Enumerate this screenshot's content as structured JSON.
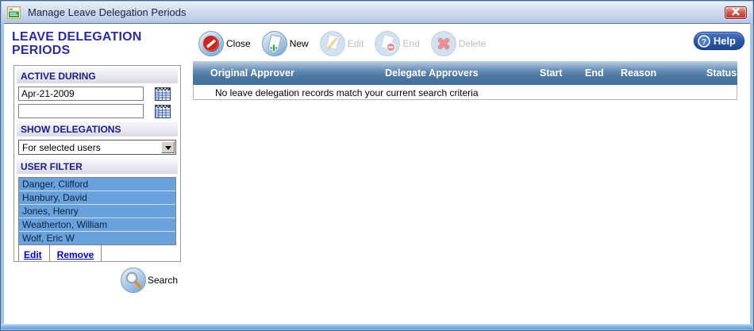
{
  "window": {
    "title": "Manage Leave Delegation Periods",
    "close_glyph": "x",
    "app_icon": "form-window-icon"
  },
  "page": {
    "heading": "LEAVE DELEGATION PERIODS"
  },
  "toolbar": {
    "buttons": [
      {
        "label": "Close",
        "icon": "close-icon",
        "enabled": true
      },
      {
        "label": "New",
        "icon": "new-icon",
        "enabled": true
      },
      {
        "label": "Edit",
        "icon": "edit-icon",
        "enabled": false
      },
      {
        "label": "End",
        "icon": "end-icon",
        "enabled": false
      },
      {
        "label": "Delete",
        "icon": "delete-icon",
        "enabled": false
      }
    ],
    "help_label": "Help"
  },
  "panel": {
    "active_during": {
      "label": "ACTIVE DURING",
      "date_from": "Apr-21-2009",
      "date_to": ""
    },
    "show_delegations": {
      "label": "SHOW DELEGATIONS",
      "selected_option": "For selected users"
    },
    "user_filter": {
      "label": "USER FILTER",
      "users": [
        "Danger, Clifford",
        "Hanbury, David",
        "Jones, Henry",
        "Weatherton, William",
        "Wolf, Eric W"
      ],
      "edit_link": "Edit",
      "remove_link": "Remove"
    },
    "search_label": "Search"
  },
  "table": {
    "columns": [
      "Original Approver",
      "Delegate Approvers",
      "Start",
      "End",
      "Reason",
      "Status"
    ],
    "empty_message": "No leave delegation records match your current search criteria"
  },
  "colors": {
    "heading_blue": "#2b2ba2",
    "section_blue": "#1b1b8f",
    "grid_header_blue": "#44719e",
    "selection_blue": "#68a1dc",
    "help_button_blue": "#2a55a6",
    "close_red": "#b23a32",
    "link_blue": "#0000c8"
  }
}
